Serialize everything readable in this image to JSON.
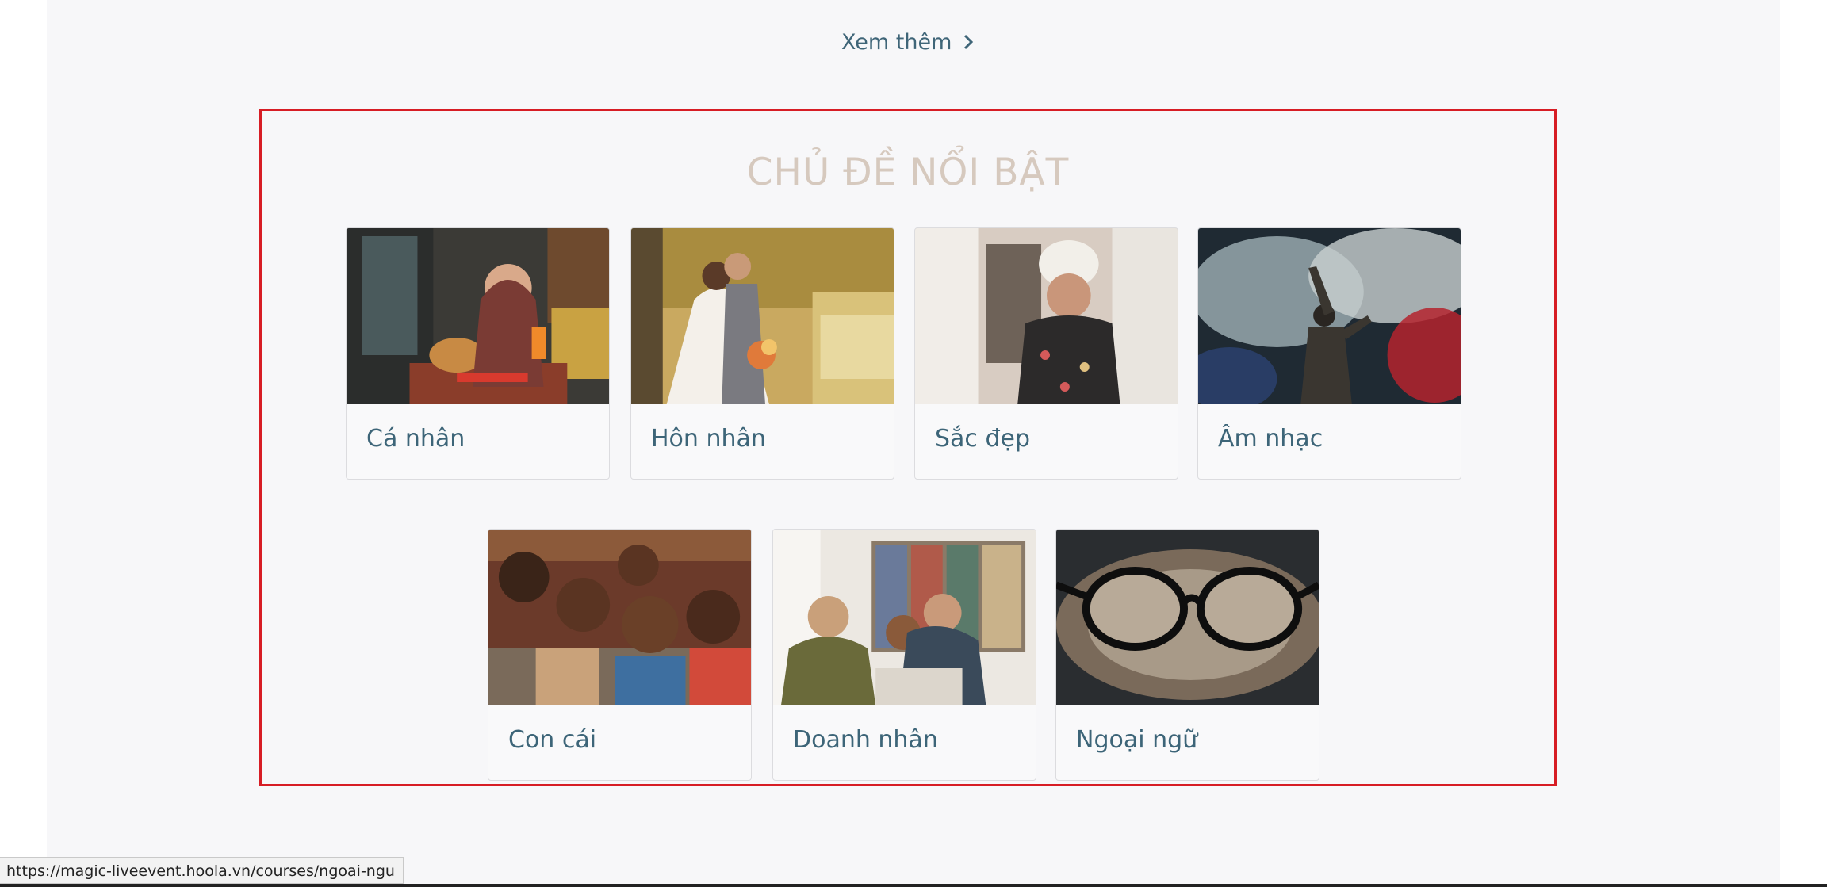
{
  "see_more": {
    "label": "Xem thêm",
    "icon": "chevron-right-icon"
  },
  "section": {
    "title": "CHỦ ĐỀ NỔI BẬT",
    "border_color": "#d71d25"
  },
  "categories": [
    {
      "label": "Cá nhân"
    },
    {
      "label": "Hôn nhân"
    },
    {
      "label": "Sắc đẹp"
    },
    {
      "label": "Âm nhạc"
    },
    {
      "label": "Con cái"
    },
    {
      "label": "Doanh nhân"
    },
    {
      "label": "Ngoại ngữ"
    }
  ],
  "status_bar": {
    "url": "https://magic-liveevent.hoola.vn/courses/ngoai-ngu"
  },
  "colors": {
    "link": "#3f6578",
    "title": "#d6c9be",
    "card_label": "#3d6578"
  }
}
